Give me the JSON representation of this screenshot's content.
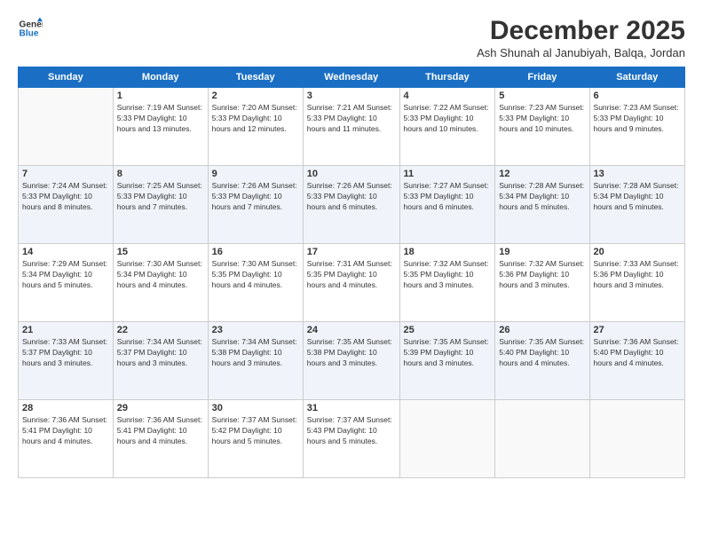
{
  "logo": {
    "line1": "General",
    "line2": "Blue"
  },
  "title": "December 2025",
  "subtitle": "Ash Shunah al Janubiyah, Balqa, Jordan",
  "days_of_week": [
    "Sunday",
    "Monday",
    "Tuesday",
    "Wednesday",
    "Thursday",
    "Friday",
    "Saturday"
  ],
  "weeks": [
    [
      {
        "day": "",
        "info": ""
      },
      {
        "day": "1",
        "info": "Sunrise: 7:19 AM\nSunset: 5:33 PM\nDaylight: 10 hours\nand 13 minutes."
      },
      {
        "day": "2",
        "info": "Sunrise: 7:20 AM\nSunset: 5:33 PM\nDaylight: 10 hours\nand 12 minutes."
      },
      {
        "day": "3",
        "info": "Sunrise: 7:21 AM\nSunset: 5:33 PM\nDaylight: 10 hours\nand 11 minutes."
      },
      {
        "day": "4",
        "info": "Sunrise: 7:22 AM\nSunset: 5:33 PM\nDaylight: 10 hours\nand 10 minutes."
      },
      {
        "day": "5",
        "info": "Sunrise: 7:23 AM\nSunset: 5:33 PM\nDaylight: 10 hours\nand 10 minutes."
      },
      {
        "day": "6",
        "info": "Sunrise: 7:23 AM\nSunset: 5:33 PM\nDaylight: 10 hours\nand 9 minutes."
      }
    ],
    [
      {
        "day": "7",
        "info": "Sunrise: 7:24 AM\nSunset: 5:33 PM\nDaylight: 10 hours\nand 8 minutes."
      },
      {
        "day": "8",
        "info": "Sunrise: 7:25 AM\nSunset: 5:33 PM\nDaylight: 10 hours\nand 7 minutes."
      },
      {
        "day": "9",
        "info": "Sunrise: 7:26 AM\nSunset: 5:33 PM\nDaylight: 10 hours\nand 7 minutes."
      },
      {
        "day": "10",
        "info": "Sunrise: 7:26 AM\nSunset: 5:33 PM\nDaylight: 10 hours\nand 6 minutes."
      },
      {
        "day": "11",
        "info": "Sunrise: 7:27 AM\nSunset: 5:33 PM\nDaylight: 10 hours\nand 6 minutes."
      },
      {
        "day": "12",
        "info": "Sunrise: 7:28 AM\nSunset: 5:34 PM\nDaylight: 10 hours\nand 5 minutes."
      },
      {
        "day": "13",
        "info": "Sunrise: 7:28 AM\nSunset: 5:34 PM\nDaylight: 10 hours\nand 5 minutes."
      }
    ],
    [
      {
        "day": "14",
        "info": "Sunrise: 7:29 AM\nSunset: 5:34 PM\nDaylight: 10 hours\nand 5 minutes."
      },
      {
        "day": "15",
        "info": "Sunrise: 7:30 AM\nSunset: 5:34 PM\nDaylight: 10 hours\nand 4 minutes."
      },
      {
        "day": "16",
        "info": "Sunrise: 7:30 AM\nSunset: 5:35 PM\nDaylight: 10 hours\nand 4 minutes."
      },
      {
        "day": "17",
        "info": "Sunrise: 7:31 AM\nSunset: 5:35 PM\nDaylight: 10 hours\nand 4 minutes."
      },
      {
        "day": "18",
        "info": "Sunrise: 7:32 AM\nSunset: 5:35 PM\nDaylight: 10 hours\nand 3 minutes."
      },
      {
        "day": "19",
        "info": "Sunrise: 7:32 AM\nSunset: 5:36 PM\nDaylight: 10 hours\nand 3 minutes."
      },
      {
        "day": "20",
        "info": "Sunrise: 7:33 AM\nSunset: 5:36 PM\nDaylight: 10 hours\nand 3 minutes."
      }
    ],
    [
      {
        "day": "21",
        "info": "Sunrise: 7:33 AM\nSunset: 5:37 PM\nDaylight: 10 hours\nand 3 minutes."
      },
      {
        "day": "22",
        "info": "Sunrise: 7:34 AM\nSunset: 5:37 PM\nDaylight: 10 hours\nand 3 minutes."
      },
      {
        "day": "23",
        "info": "Sunrise: 7:34 AM\nSunset: 5:38 PM\nDaylight: 10 hours\nand 3 minutes."
      },
      {
        "day": "24",
        "info": "Sunrise: 7:35 AM\nSunset: 5:38 PM\nDaylight: 10 hours\nand 3 minutes."
      },
      {
        "day": "25",
        "info": "Sunrise: 7:35 AM\nSunset: 5:39 PM\nDaylight: 10 hours\nand 3 minutes."
      },
      {
        "day": "26",
        "info": "Sunrise: 7:35 AM\nSunset: 5:40 PM\nDaylight: 10 hours\nand 4 minutes."
      },
      {
        "day": "27",
        "info": "Sunrise: 7:36 AM\nSunset: 5:40 PM\nDaylight: 10 hours\nand 4 minutes."
      }
    ],
    [
      {
        "day": "28",
        "info": "Sunrise: 7:36 AM\nSunset: 5:41 PM\nDaylight: 10 hours\nand 4 minutes."
      },
      {
        "day": "29",
        "info": "Sunrise: 7:36 AM\nSunset: 5:41 PM\nDaylight: 10 hours\nand 4 minutes."
      },
      {
        "day": "30",
        "info": "Sunrise: 7:37 AM\nSunset: 5:42 PM\nDaylight: 10 hours\nand 5 minutes."
      },
      {
        "day": "31",
        "info": "Sunrise: 7:37 AM\nSunset: 5:43 PM\nDaylight: 10 hours\nand 5 minutes."
      },
      {
        "day": "",
        "info": ""
      },
      {
        "day": "",
        "info": ""
      },
      {
        "day": "",
        "info": ""
      }
    ]
  ]
}
